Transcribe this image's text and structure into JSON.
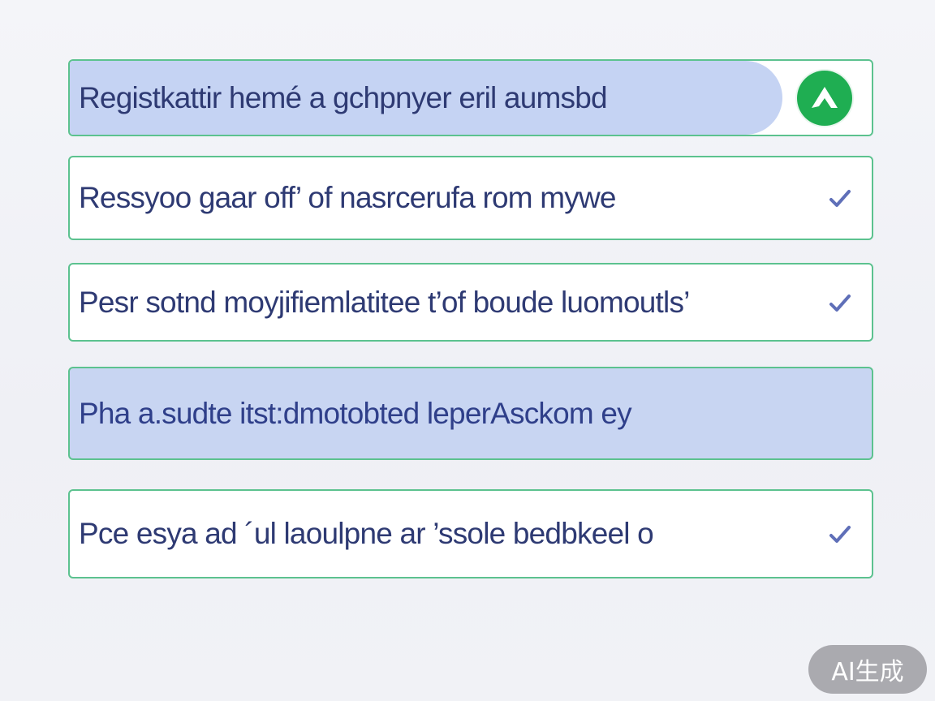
{
  "options": [
    {
      "label": "Registkattir hemé a gchpnyer eril aumsbd",
      "selected": false,
      "highlighted": true,
      "icon": "up-arrow-badge-icon"
    },
    {
      "label": "Ressyoo gaar off’ of nasrcerufa  rom mywe",
      "selected": true,
      "highlighted": false,
      "icon": "check-icon"
    },
    {
      "label": "Pesr sotnd moyjifiemlatitee t’of boude luomoutls’",
      "selected": true,
      "highlighted": false,
      "icon": "check-icon"
    },
    {
      "label": "Pha a.sudte  itst:dmotobted leperAsckom ey",
      "selected": false,
      "highlighted": true,
      "icon": ""
    },
    {
      "label": "Pce esya ad ´ul laoulpne ar ’ssole bedbkeel o",
      "selected": true,
      "highlighted": false,
      "icon": "check-icon"
    }
  ],
  "colors": {
    "border": "#5cc28f",
    "highlight": "#c8d5f2",
    "text": "#2e3a73",
    "check": "#5f6fb8",
    "badge": "#1fae52"
  },
  "watermark": {
    "label": "AI生成"
  }
}
